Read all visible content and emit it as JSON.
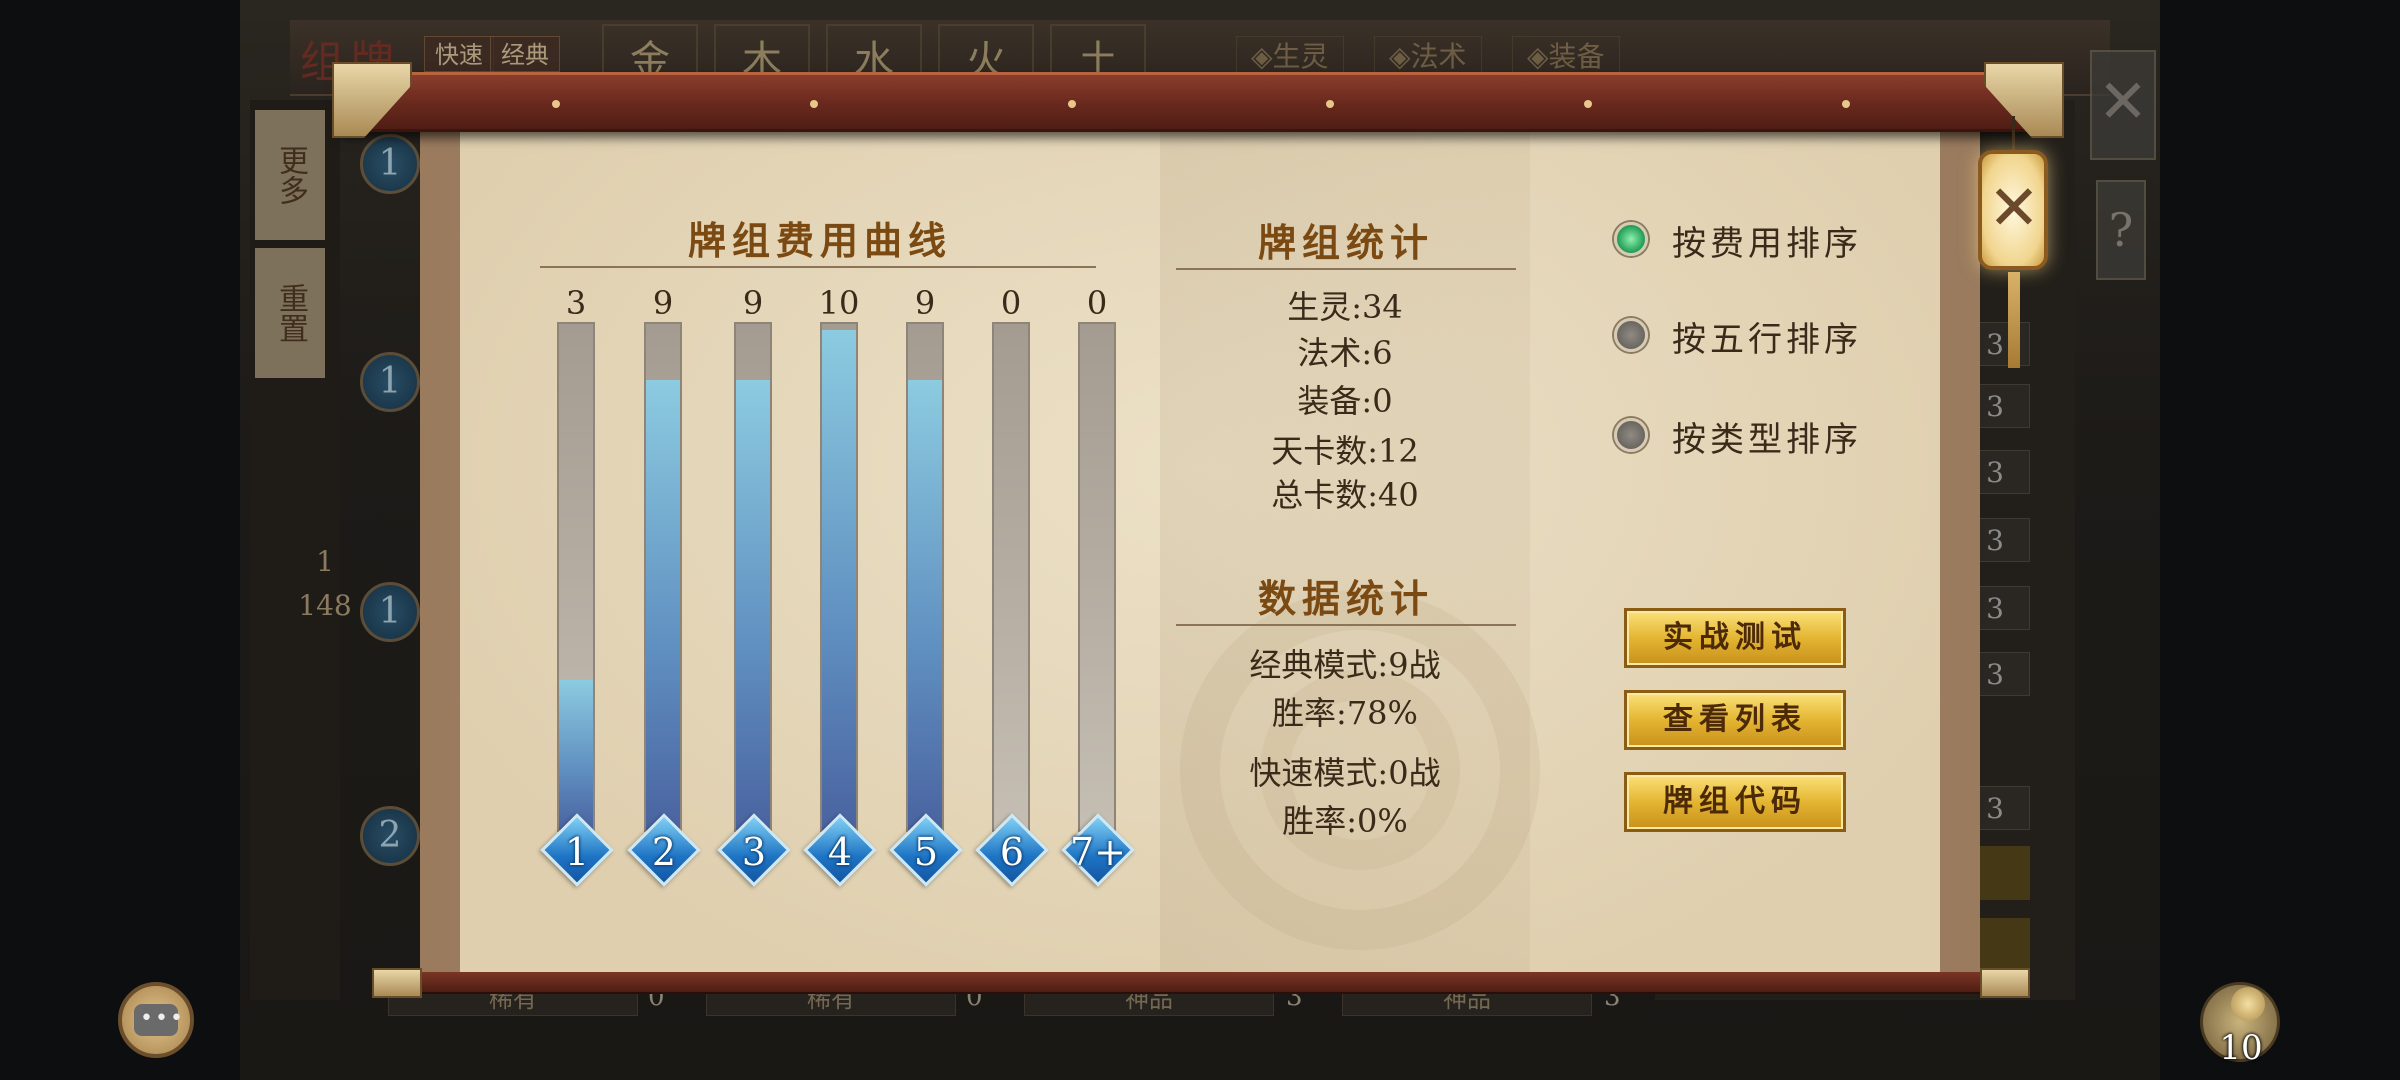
{
  "background": {
    "title": "组牌",
    "modes": [
      "快速",
      "经典"
    ],
    "elements": [
      "金",
      "木",
      "水",
      "火",
      "土"
    ],
    "filters": [
      "◈生灵",
      "◈法术",
      "◈装备"
    ],
    "side_tabs": [
      "更多",
      "重置"
    ],
    "count_top": "1",
    "count_bottom": "148",
    "cost_dots": [
      "1",
      "1",
      "1",
      "2"
    ],
    "right_rows": [
      "3",
      "3",
      "3",
      "3",
      "3",
      "3",
      "3"
    ],
    "bottom_slots": [
      {
        "label": "稀有",
        "num": "0"
      },
      {
        "label": "稀有",
        "num": "0"
      },
      {
        "label": "神品",
        "num": "3"
      },
      {
        "label": "神品",
        "num": "3"
      }
    ],
    "close_glyph": "✕",
    "help_glyph": "?"
  },
  "cost_curve": {
    "title": "牌组费用曲线",
    "max": 10,
    "bars": [
      {
        "cost": "1",
        "count": 3
      },
      {
        "cost": "2",
        "count": 9
      },
      {
        "cost": "3",
        "count": 9
      },
      {
        "cost": "4",
        "count": 10
      },
      {
        "cost": "5",
        "count": 9
      },
      {
        "cost": "6",
        "count": 0
      },
      {
        "cost": "7+",
        "count": 0
      }
    ]
  },
  "deck_stats": {
    "title": "牌组统计",
    "lines": [
      "生灵:34",
      "法术:6",
      "装备:0",
      "天卡数:12",
      "总卡数:40"
    ]
  },
  "data_stats": {
    "title": "数据统计",
    "classic_games": "经典模式:9战",
    "classic_winrate": "胜率:78%",
    "quick_games": "快速模式:0战",
    "quick_winrate": "胜率:0%"
  },
  "sort_options": [
    {
      "label": "按费用排序",
      "selected": true
    },
    {
      "label": "按五行排序",
      "selected": false
    },
    {
      "label": "按类型排序",
      "selected": false
    }
  ],
  "buttons": {
    "test": "实战测试",
    "list": "查看列表",
    "code": "牌组代码"
  },
  "close_icon": "close-icon",
  "chat_icon": "chat-icon",
  "bag_count": "10",
  "colors": {
    "accent_gold": "#e4b532",
    "bar_blue": "#5f8fc0",
    "radio_green": "#1f9a54",
    "title_brown": "#7b4a12"
  }
}
